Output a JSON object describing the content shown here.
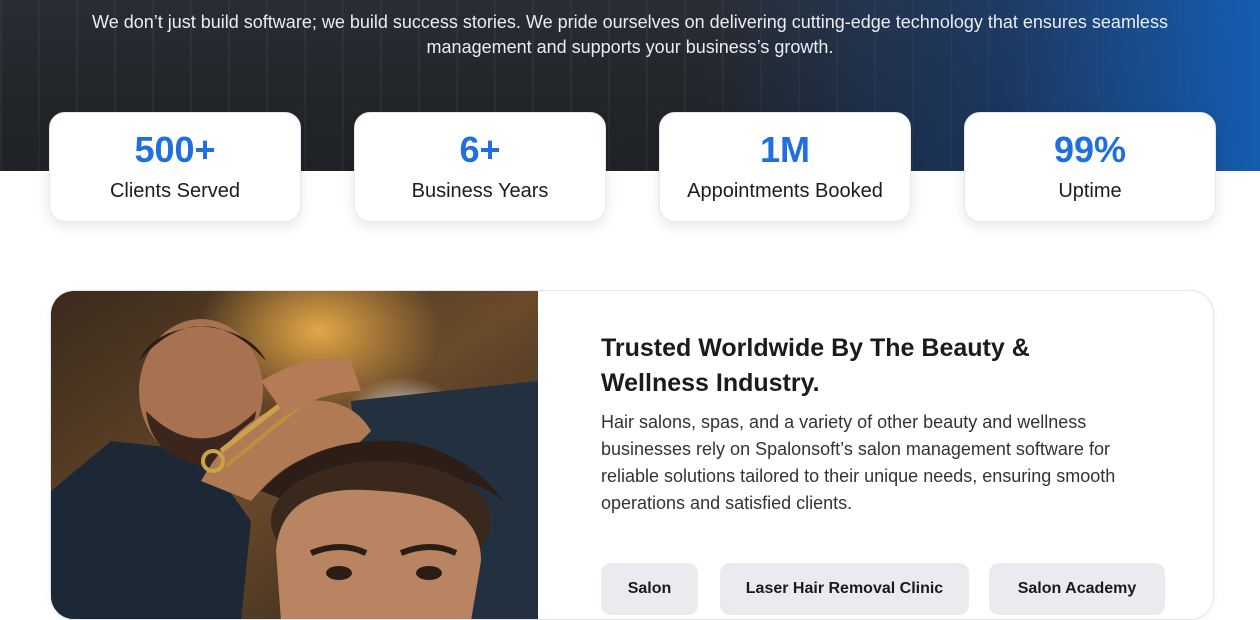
{
  "hero": {
    "line1": "We don’t just build software; we build success stories. We pride ourselves on delivering cutting-edge technology that ensures seamless",
    "line2": "management and supports your business’s growth."
  },
  "stats": [
    {
      "value": "500+",
      "label": "Clients Served"
    },
    {
      "value": "6+",
      "label": "Business Years"
    },
    {
      "value": "1M",
      "label": "Appointments Booked"
    },
    {
      "value": "99%",
      "label": "Uptime"
    }
  ],
  "feature": {
    "title_line1": "Trusted Worldwide By The Beauty &",
    "title_line2": "Wellness Industry.",
    "description": "Hair salons, spas, and a variety of other beauty and wellness businesses rely on Spalonsoft’s salon management software for reliable solutions tailored to their unique needs, ensuring smooth operations and satisfied clients.",
    "image_icon": "barber-photo",
    "tags": [
      "Salon",
      "Laser Hair Removal Clinic",
      "Salon Academy"
    ]
  },
  "colors": {
    "accent": "#1f6fde",
    "hero_dark": "#23262b",
    "hero_blue": "#145fb9",
    "tag_bg": "#e9ebee"
  }
}
